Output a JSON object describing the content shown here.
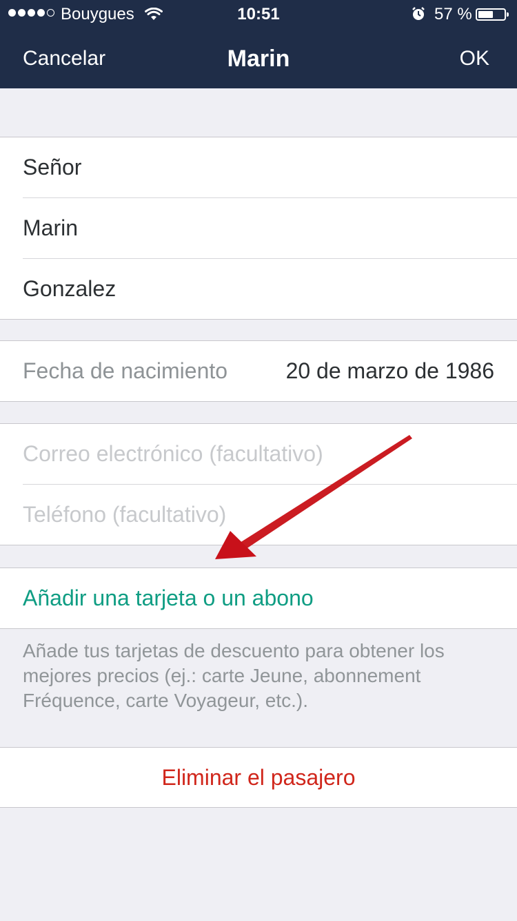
{
  "status_bar": {
    "carrier": "Bouygues",
    "time": "10:51",
    "battery_percent": "57 %",
    "battery_level": 0.57,
    "signal_bars_filled": 4,
    "signal_bars_total": 5,
    "icons": [
      "signal-icon",
      "wifi-icon",
      "alarm-icon",
      "battery-icon"
    ]
  },
  "nav": {
    "cancel_label": "Cancelar",
    "title": "Marin",
    "ok_label": "OK"
  },
  "name_group": {
    "title_value": "Señor",
    "first_name": "Marin",
    "last_name": "Gonzalez"
  },
  "birth": {
    "label": "Fecha de nacimiento",
    "value": "20 de marzo de 1986"
  },
  "contact": {
    "email_placeholder": "Correo electrónico (facultativo)",
    "phone_placeholder": "Teléfono (facultativo)"
  },
  "card": {
    "add_label": "Añadir una tarjeta o un abono",
    "footnote": "Añade tus tarjetas de descuento para obtener los mejores precios (ej.: carte Jeune, abonnement Fréquence, carte Voyageur, etc.)."
  },
  "delete": {
    "label": "Eliminar el pasajero"
  },
  "colors": {
    "nav_background": "#1f2d48",
    "accent": "#0f9d83",
    "danger": "#d0261b",
    "annotation_arrow": "#d4141c"
  }
}
